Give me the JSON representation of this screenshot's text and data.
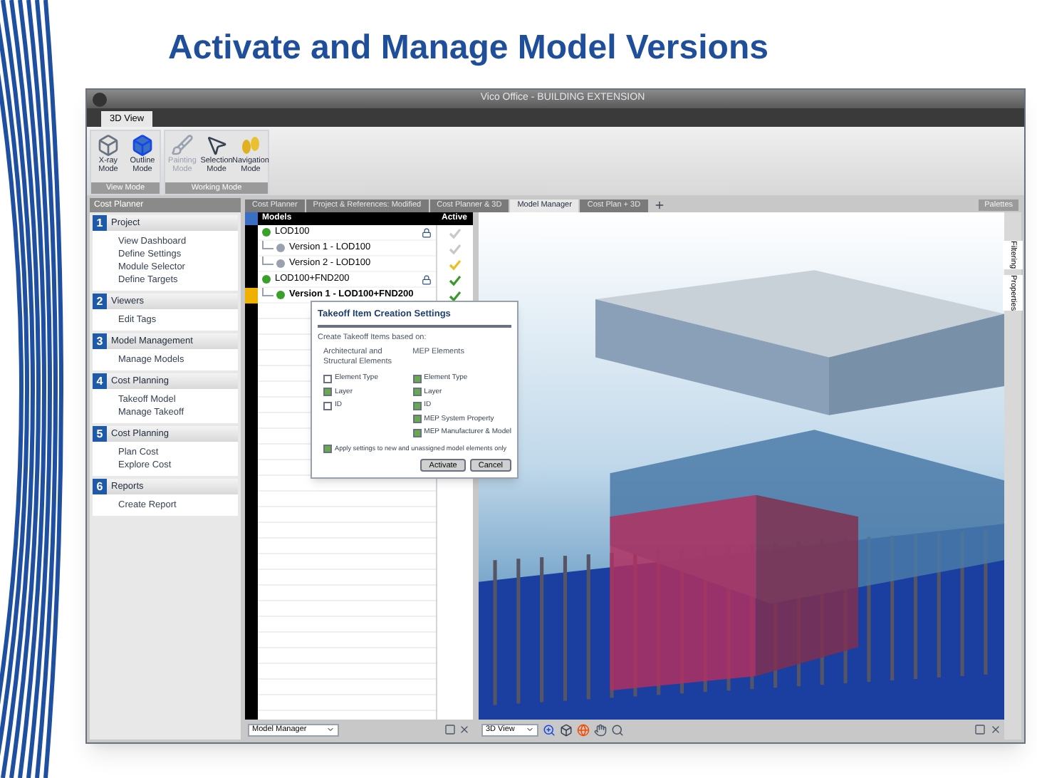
{
  "slide": {
    "title": "Activate and Manage Model Versions"
  },
  "window": {
    "title": "Vico Office - BUILDING EXTENSION"
  },
  "ribbon": {
    "tabs": [
      {
        "label": "3D View",
        "selected": true
      }
    ],
    "groups": [
      {
        "label": "View Mode",
        "buttons": [
          {
            "label": "X-ray Mode",
            "kind": "xray",
            "disabled": false
          },
          {
            "label": "Outline Mode",
            "kind": "outline",
            "disabled": false
          }
        ]
      },
      {
        "label": "Working Mode",
        "buttons": [
          {
            "label": "Painting Mode",
            "kind": "paint",
            "disabled": true
          },
          {
            "label": "Selection Mode",
            "kind": "select",
            "disabled": false
          },
          {
            "label": "Navigation Mode",
            "kind": "navigate",
            "disabled": false
          }
        ]
      }
    ]
  },
  "sidebar": {
    "title": "Cost Planner",
    "sections": [
      {
        "number": "1",
        "title": "Project",
        "items": [
          "View Dashboard",
          "Define Settings",
          "Module Selector",
          "Define Targets"
        ]
      },
      {
        "number": "2",
        "title": "Viewers",
        "items": [
          "Edit Tags"
        ]
      },
      {
        "number": "3",
        "title": "Model Management",
        "items": [
          "Manage Models"
        ]
      },
      {
        "number": "4",
        "title": "Cost Planning",
        "items": [
          "Takeoff Model",
          "Manage Takeoff"
        ]
      },
      {
        "number": "5",
        "title": "Cost Planning",
        "items": [
          "Plan Cost",
          "Explore Cost"
        ]
      },
      {
        "number": "6",
        "title": "Reports",
        "items": [
          "Create Report"
        ]
      }
    ]
  },
  "doc_tabs": [
    {
      "label": "Cost Planner",
      "selected": false
    },
    {
      "label": "Project & References: Modified",
      "selected": false
    },
    {
      "label": "Cost Planner & 3D",
      "selected": false
    },
    {
      "label": "Model Manager",
      "selected": true
    },
    {
      "label": "Cost Plan + 3D",
      "selected": false
    }
  ],
  "palettes_button": "Palettes",
  "models": {
    "columns": [
      "Models",
      "Active"
    ],
    "rows": [
      {
        "label": "LOD100",
        "selected": false,
        "color": "#c8c8c8",
        "children": [
          {
            "label": "Version 1 - LOD100",
            "selected": false,
            "color": "#c8c8c8"
          },
          {
            "label": "Version 2 - LOD100",
            "selected": false,
            "color": "#e8c020"
          }
        ]
      },
      {
        "label": "LOD100+FND200",
        "selected": false,
        "color": "#3a9a2a",
        "children": [
          {
            "label": "Version 1 - LOD100+FND200",
            "selected": true,
            "color": "#3a9a2a"
          }
        ]
      }
    ]
  },
  "dialog": {
    "title": "Takeoff Item Creation Settings",
    "intro": "Create Takeoff Items based on:",
    "columns": [
      {
        "heading": "Architectural and Structural Elements",
        "options": [
          {
            "label": "Element Type",
            "checked": false
          },
          {
            "label": "Layer",
            "checked": true
          },
          {
            "label": "ID",
            "checked": false
          }
        ]
      },
      {
        "heading": "MEP Elements",
        "options": [
          {
            "label": "Element Type",
            "checked": true
          },
          {
            "label": "Layer",
            "checked": true
          },
          {
            "label": "ID",
            "checked": true
          },
          {
            "label": "MEP System Property",
            "checked": true
          },
          {
            "label": "MEP Manufacturer & Model",
            "checked": true
          }
        ]
      }
    ],
    "apply_option": {
      "label": "Apply settings to new and unassigned model elements only",
      "checked": true
    },
    "buttons": [
      "Activate",
      "Cancel"
    ]
  },
  "side_tabs": [
    "Filtering",
    "Properties"
  ],
  "bottom_bars": {
    "left_select": "Model Manager",
    "right_select": "3D View"
  }
}
